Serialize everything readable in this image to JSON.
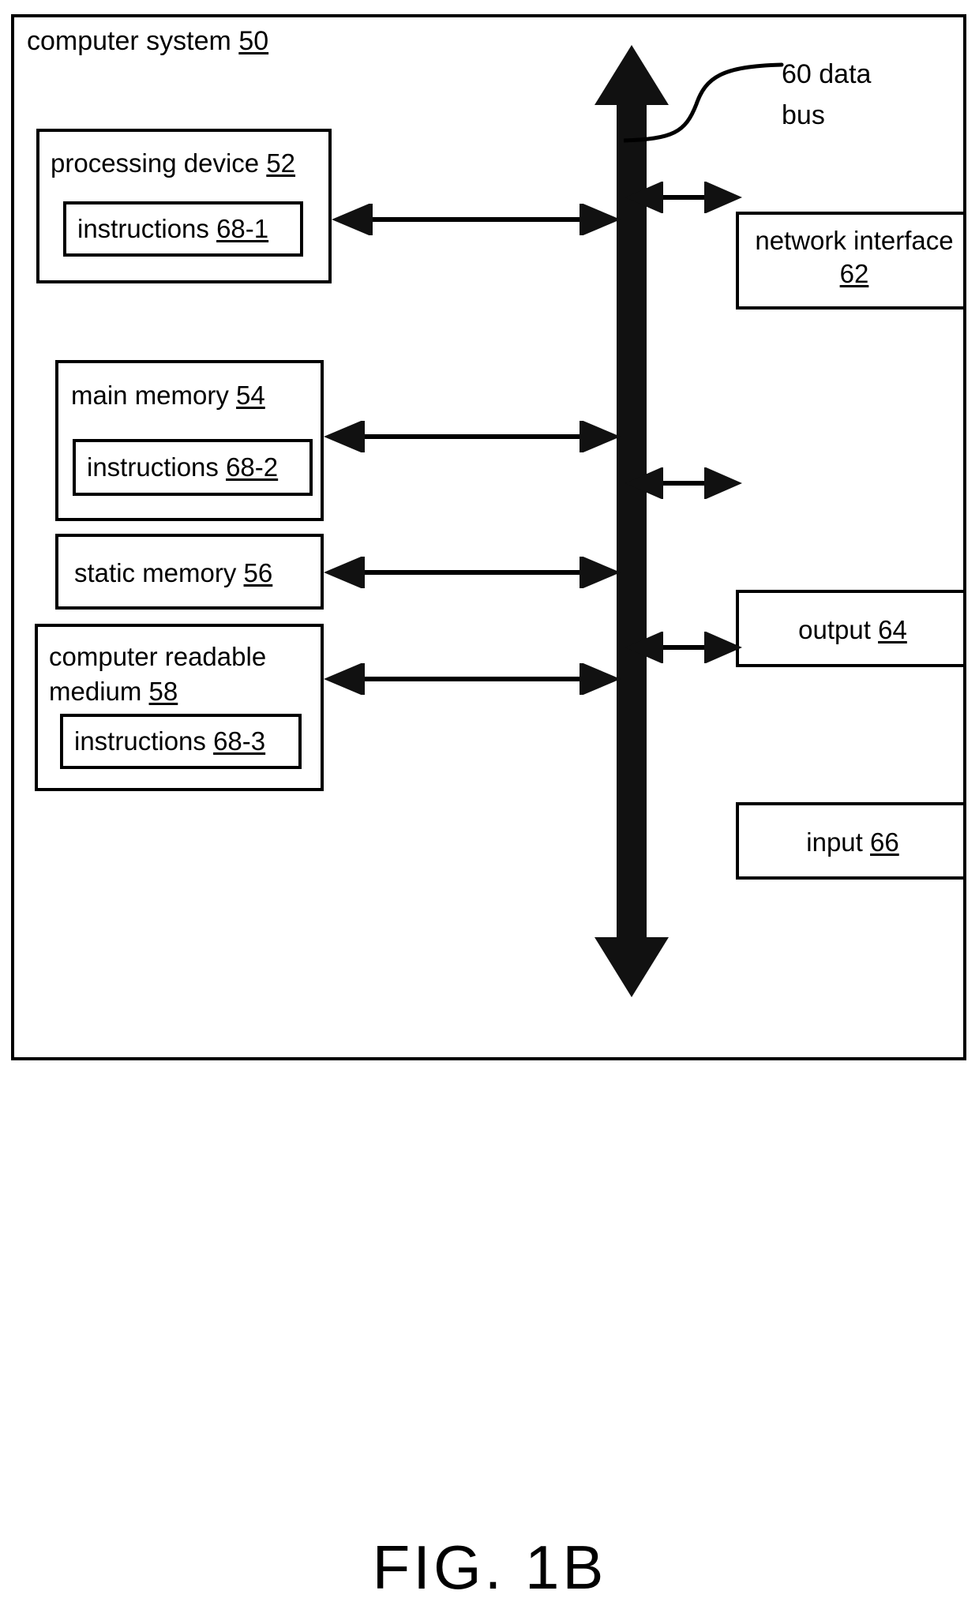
{
  "figure": {
    "caption": "FIG. 1B",
    "system_title_text": "computer system ",
    "system_title_num": "50"
  },
  "bus": {
    "label": "60 data\nbus",
    "name": "data bus",
    "ref": "60"
  },
  "blocks": {
    "processing_device": {
      "label": "processing device ",
      "num": "52",
      "inner": {
        "label": "instructions ",
        "num": "68-1"
      }
    },
    "main_memory": {
      "label": "main memory ",
      "num": "54",
      "inner": {
        "label": "instructions ",
        "num": "68-2"
      }
    },
    "static_memory": {
      "label": "static memory ",
      "num": "56"
    },
    "computer_readable_medium": {
      "label": "computer readable medium ",
      "num": "58",
      "inner": {
        "label": "instructions ",
        "num": "68-3"
      }
    },
    "network_interface": {
      "label": "network interface ",
      "num": "62"
    },
    "output": {
      "label": "output ",
      "num": "64"
    },
    "input": {
      "label": "input ",
      "num": "66"
    }
  },
  "colors": {
    "stroke": "#000000",
    "background": "#ffffff"
  }
}
